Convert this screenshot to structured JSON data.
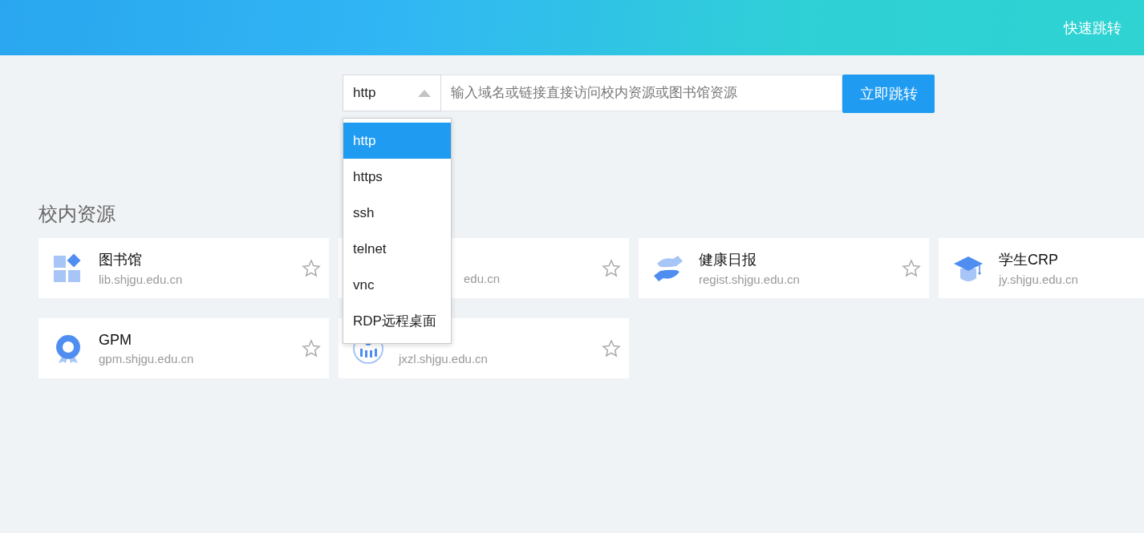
{
  "header": {
    "link": "快速跳转"
  },
  "jump": {
    "protocol": "http",
    "placeholder": "输入域名或链接直接访问校内资源或图书馆资源",
    "button": "立即跳转",
    "options": [
      {
        "label": "http",
        "selected": true
      },
      {
        "label": "https",
        "selected": false
      },
      {
        "label": "ssh",
        "selected": false
      },
      {
        "label": "telnet",
        "selected": false
      },
      {
        "label": "vnc",
        "selected": false
      },
      {
        "label": "RDP远程桌面",
        "selected": false
      }
    ]
  },
  "section": {
    "title": "校内资源",
    "cards": [
      {
        "title": "图书馆",
        "url": "lib.shjgu.edu.cn"
      },
      {
        "url": "edu.cn",
        "covered": true
      },
      {
        "title": "健康日报",
        "url": "regist.shjgu.edu.cn"
      },
      {
        "title": "学生CRP",
        "url": "jy.shjgu.edu.cn"
      },
      {
        "title": "GPM",
        "url": "gpm.shjgu.edu.cn"
      },
      {
        "url": "jxzl.shjgu.edu.cn"
      }
    ]
  }
}
